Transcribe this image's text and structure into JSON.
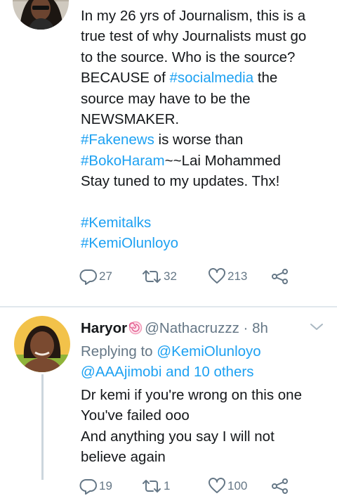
{
  "tweet1": {
    "lines": [
      [
        {
          "t": "In my 26 yrs of Journalism, this is a"
        }
      ],
      [
        {
          "t": "true test of why Journalists must go"
        }
      ],
      [
        {
          "t": "to the source. Who is the source?"
        }
      ],
      [
        {
          "t": "BECAUSE of "
        },
        {
          "t": "#socialmedia",
          "link": true
        },
        {
          "t": " the"
        }
      ],
      [
        {
          "t": "source may have to be the"
        }
      ],
      [
        {
          "t": "NEWSMAKER."
        }
      ],
      [
        {
          "t": "#Fakenews",
          "link": true
        },
        {
          "t": " is worse than"
        }
      ],
      [
        {
          "t": "#BokoHaram",
          "link": true
        },
        {
          "t": "~~Lai Mohammed"
        }
      ],
      [
        {
          "t": "Stay tuned to my updates. Thx!"
        }
      ],
      [],
      [
        {
          "t": "#Kemitalks",
          "link": true
        }
      ],
      [
        {
          "t": "#KemiOlunloyo",
          "link": true
        }
      ]
    ],
    "replies": "27",
    "retweets": "32",
    "likes": "213"
  },
  "tweet2": {
    "name": "Haryor",
    "handle": "@Nathacruzzz",
    "separator": " · ",
    "time": "8h",
    "replying_prefix": "Replying to ",
    "replying_user": "@KemiOlunloyo",
    "replying_others": "@AAAjimobi and 10 others",
    "lines": [
      [
        {
          "t": "Dr kemi if you're wrong on this one"
        }
      ],
      [
        {
          "t": "You've failed ooo"
        }
      ],
      [
        {
          "t": "And anything you say I will not"
        }
      ],
      [
        {
          "t": "believe again"
        }
      ]
    ],
    "replies": "19",
    "retweets": "1",
    "likes": "100"
  },
  "icons": {
    "reply": "reply-icon",
    "retweet": "retweet-icon",
    "like": "heart-icon",
    "share": "share-icon",
    "menu": "chevron-down-icon"
  },
  "colors": {
    "link": "#1da1f2",
    "secondary": "#657786",
    "divider": "#e1e8ed"
  }
}
